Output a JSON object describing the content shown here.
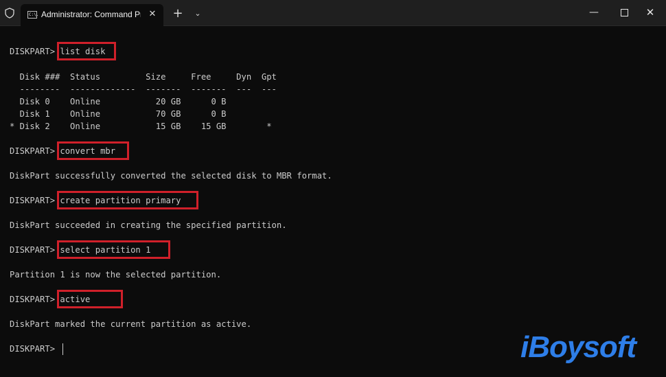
{
  "window": {
    "tab_title": "Administrator: Command Prompt",
    "tab_icon_text": "C:\\.",
    "new_tab": "+",
    "dropdown": "⌄",
    "minimize": "—",
    "close": "✕",
    "tab_close": "✕"
  },
  "terminal": {
    "lines": [
      "DISKPART> list disk",
      "  Disk ###  Status         Size     Free     Dyn  Gpt",
      "  --------  -------------  -------  -------  ---  ---",
      "  Disk 0    Online           20 GB      0 B",
      "  Disk 1    Online           70 GB      0 B",
      "* Disk 2    Online           15 GB    15 GB        *",
      "DISKPART> convert mbr",
      "DiskPart successfully converted the selected disk to MBR format.",
      "DISKPART> create partition primary",
      "DiskPart succeeded in creating the specified partition.",
      "DISKPART> select partition 1",
      "Partition 1 is now the selected partition.",
      "DISKPART> active",
      "DiskPart marked the current partition as active.",
      "DISKPART> "
    ]
  },
  "watermark": {
    "text": "iBoysoft",
    "color": "#2e7ee8"
  },
  "colors": {
    "highlight": "#d0202a",
    "text": "#cccccc",
    "background": "#0c0c0c"
  }
}
